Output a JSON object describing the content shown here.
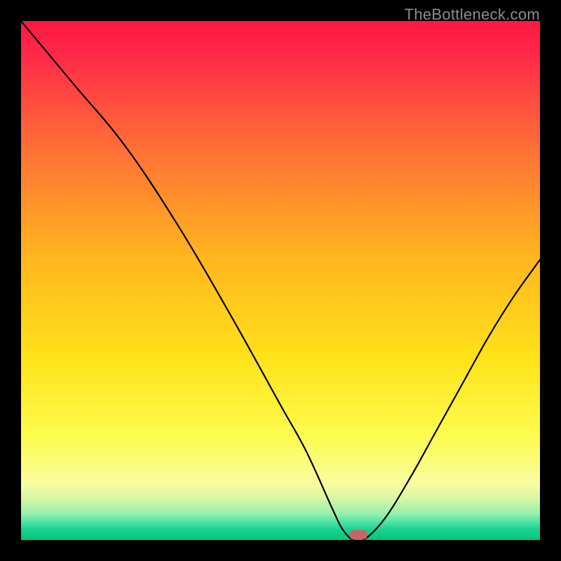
{
  "watermark": "TheBottleneck.com",
  "chart_data": {
    "type": "line",
    "title": "",
    "xlabel": "",
    "ylabel": "",
    "xlim": [
      0,
      100
    ],
    "ylim": [
      0,
      100
    ],
    "grid": false,
    "legend": false,
    "series": [
      {
        "name": "bottleneck-curve",
        "x": [
          0,
          10,
          20,
          30,
          40,
          50,
          55,
          60,
          62,
          64,
          66,
          70,
          75,
          80,
          85,
          90,
          95,
          100
        ],
        "values": [
          100,
          88,
          76,
          61,
          44,
          26,
          17,
          6,
          2,
          0,
          0,
          4,
          12,
          21,
          30,
          39,
          47,
          54
        ]
      }
    ],
    "marker": {
      "x": 65,
      "y": 1,
      "color": "#c86464",
      "shape": "rounded-rect"
    },
    "background": {
      "type": "vertical-gradient",
      "stops": [
        {
          "pos": 0.0,
          "color": "#ff1744"
        },
        {
          "pos": 0.06,
          "color": "#ff2749"
        },
        {
          "pos": 0.25,
          "color": "#ff7136"
        },
        {
          "pos": 0.45,
          "color": "#ffb41f"
        },
        {
          "pos": 0.65,
          "color": "#ffe21a"
        },
        {
          "pos": 0.8,
          "color": "#fdfc4e"
        },
        {
          "pos": 0.89,
          "color": "#fafda0"
        },
        {
          "pos": 0.92,
          "color": "#d7f7a4"
        },
        {
          "pos": 0.95,
          "color": "#95efae"
        },
        {
          "pos": 0.965,
          "color": "#4fe3a8"
        },
        {
          "pos": 0.98,
          "color": "#1ad191"
        },
        {
          "pos": 1.0,
          "color": "#00c97a"
        }
      ]
    }
  }
}
